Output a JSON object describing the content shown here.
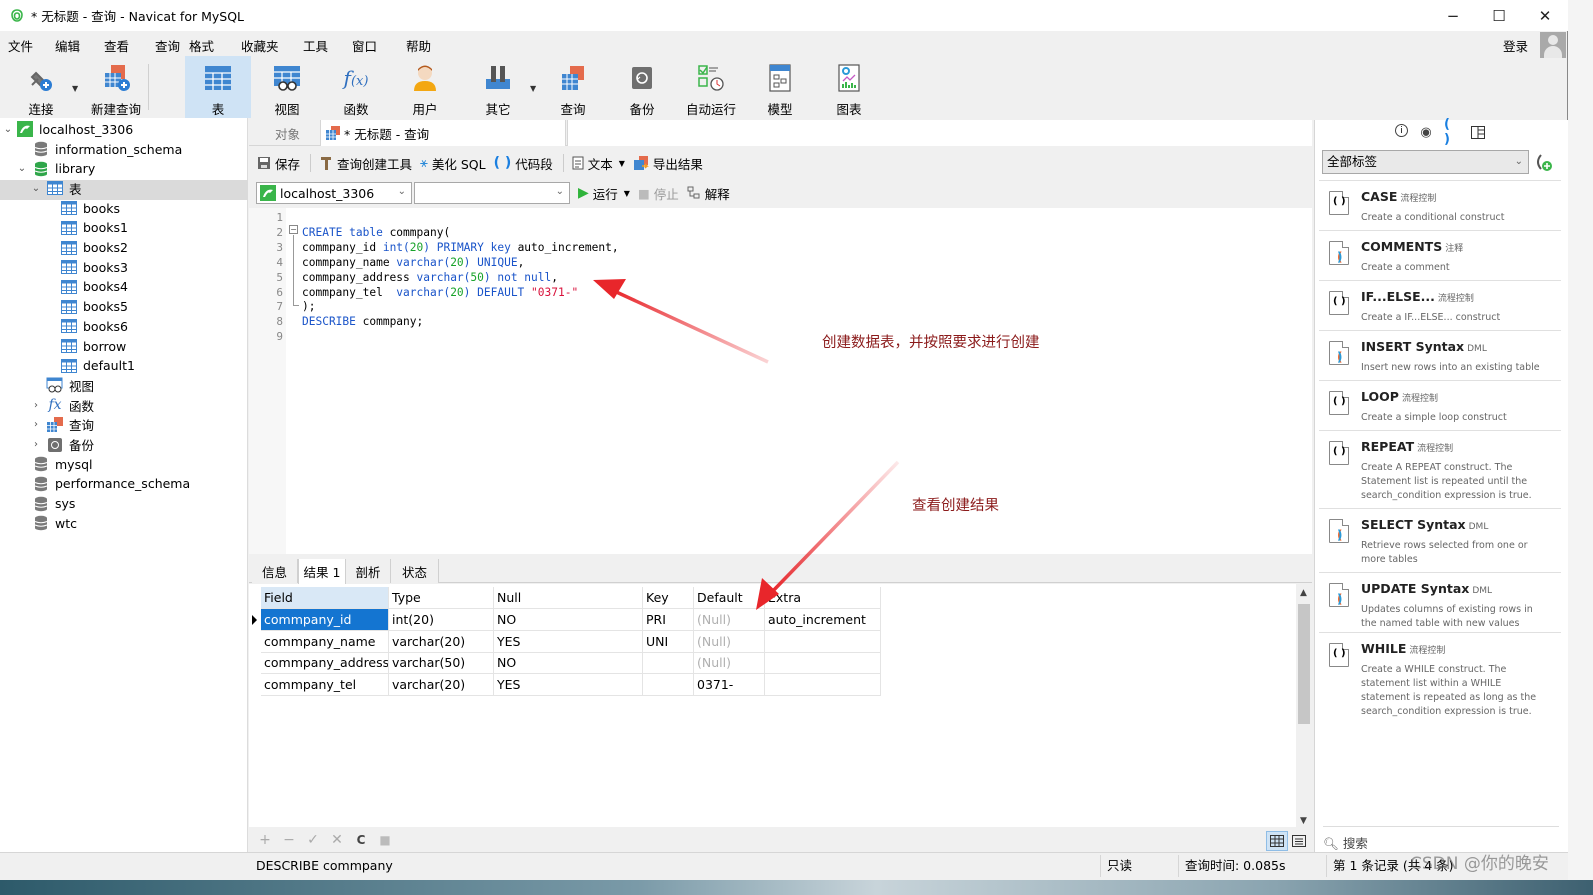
{
  "window": {
    "title": "* 无标题 - 查询 - Navicat for MySQL",
    "controls": {
      "minimize": "−",
      "maximize": "☐",
      "close": "✕"
    }
  },
  "menubar": {
    "items": [
      "文件",
      "编辑",
      "查看",
      "查询",
      "格式",
      "收藏夹",
      "工具",
      "窗口",
      "帮助"
    ],
    "login": "登录"
  },
  "toolbar": {
    "buttons": [
      {
        "label": "连接",
        "icon": "plug-add-icon"
      },
      {
        "label": "新建查询",
        "icon": "new-query-icon"
      },
      {
        "label": "表",
        "icon": "table-icon",
        "active": true
      },
      {
        "label": "视图",
        "icon": "view-icon"
      },
      {
        "label": "函数",
        "icon": "function-icon"
      },
      {
        "label": "用户",
        "icon": "user-icon"
      },
      {
        "label": "其它",
        "icon": "tools-icon"
      },
      {
        "label": "查询",
        "icon": "query-icon"
      },
      {
        "label": "备份",
        "icon": "backup-icon"
      },
      {
        "label": "自动运行",
        "icon": "schedule-icon"
      },
      {
        "label": "模型",
        "icon": "model-icon"
      },
      {
        "label": "图表",
        "icon": "chart-icon"
      }
    ]
  },
  "navigator": {
    "connection": "localhost_3306",
    "items": [
      {
        "label": "information_schema",
        "type": "database"
      },
      {
        "label": "library",
        "type": "database-open"
      },
      {
        "label": "表",
        "type": "table-group",
        "selected": true
      },
      {
        "label": "books",
        "type": "table"
      },
      {
        "label": "books1",
        "type": "table"
      },
      {
        "label": "books2",
        "type": "table"
      },
      {
        "label": "books3",
        "type": "table"
      },
      {
        "label": "books4",
        "type": "table"
      },
      {
        "label": "books5",
        "type": "table"
      },
      {
        "label": "books6",
        "type": "table"
      },
      {
        "label": "borrow",
        "type": "table"
      },
      {
        "label": "default1",
        "type": "table"
      },
      {
        "label": "视图",
        "type": "view-group"
      },
      {
        "label": "函数",
        "type": "function-group"
      },
      {
        "label": "查询",
        "type": "query-group"
      },
      {
        "label": "备份",
        "type": "backup-group"
      },
      {
        "label": "mysql",
        "type": "database"
      },
      {
        "label": "performance_schema",
        "type": "database"
      },
      {
        "label": "sys",
        "type": "database"
      },
      {
        "label": "wtc",
        "type": "database"
      }
    ]
  },
  "tabs": {
    "objects": "对象",
    "query": "* 无标题 - 查询"
  },
  "query_toolbar": {
    "save": "保存",
    "builder": "查询创建工具",
    "beautify": "美化 SQL",
    "snippet": "代码段",
    "text": "文本",
    "export": "导出结果"
  },
  "run_bar": {
    "connection": "localhost_3306",
    "database": "",
    "run": "运行",
    "stop": "停止",
    "explain": "解释"
  },
  "editor": {
    "line_numbers": [
      "1",
      "2",
      "3",
      "4",
      "5",
      "6",
      "7",
      "8",
      "9"
    ],
    "lines": [
      [],
      [
        {
          "t": "CREATE table",
          "c": "kw"
        },
        {
          "t": " commpany(",
          "c": ""
        }
      ],
      [
        {
          "t": "commpany_id ",
          "c": ""
        },
        {
          "t": "int(",
          "c": "kw"
        },
        {
          "t": "20",
          "c": "num"
        },
        {
          "t": ") PRIMARY key",
          "c": "kw"
        },
        {
          "t": " auto_increment,",
          "c": ""
        }
      ],
      [
        {
          "t": "commpany_name ",
          "c": ""
        },
        {
          "t": "varchar(",
          "c": "kw"
        },
        {
          "t": "20",
          "c": "num"
        },
        {
          "t": ") UNIQUE",
          "c": "kw"
        },
        {
          "t": ",",
          "c": ""
        }
      ],
      [
        {
          "t": "commpany_address ",
          "c": ""
        },
        {
          "t": "varchar(",
          "c": "kw"
        },
        {
          "t": "50",
          "c": "num"
        },
        {
          "t": ") not null",
          "c": "kw"
        },
        {
          "t": ",",
          "c": ""
        }
      ],
      [
        {
          "t": "commpany_tel  ",
          "c": ""
        },
        {
          "t": "varchar(",
          "c": "kw"
        },
        {
          "t": "20",
          "c": "num"
        },
        {
          "t": ") DEFAULT ",
          "c": "kw"
        },
        {
          "t": "\"0371-\"",
          "c": "str"
        }
      ],
      [
        {
          "t": ");",
          "c": ""
        }
      ],
      [
        {
          "t": "DESCRIBE",
          "c": "kw"
        },
        {
          "t": " commpany;",
          "c": ""
        }
      ],
      []
    ]
  },
  "annotations": {
    "create_note": "创建数据表，并按照要求进行创建",
    "result_note": "查看创建结果",
    "arrow_color": "#e8262b"
  },
  "result_tabs": [
    "信息",
    "结果 1",
    "剖析",
    "状态"
  ],
  "result_grid": {
    "columns": [
      "Field",
      "Type",
      "Null",
      "Key",
      "Default",
      "Extra"
    ],
    "rows": [
      [
        "commpany_id",
        "int(20)",
        "NO",
        "PRI",
        "(Null)",
        "auto_increment"
      ],
      [
        "commpany_name",
        "varchar(20)",
        "YES",
        "UNI",
        "(Null)",
        ""
      ],
      [
        "commpany_address",
        "varchar(50)",
        "NO",
        "",
        "(Null)",
        ""
      ],
      [
        "commpany_tel",
        "varchar(20)",
        "YES",
        "",
        "0371-",
        ""
      ]
    ]
  },
  "grid_toolbar": {
    "add": "+",
    "remove": "−",
    "apply": "✓",
    "discard": "✕",
    "refresh": "C",
    "stop": "■"
  },
  "statusbar": {
    "sql": "DESCRIBE commpany",
    "mode": "只读",
    "query_time": "查询时间: 0.085s",
    "record": "第 1 条记录 (共 4 条)"
  },
  "watermark": "CSDN @你的晚安",
  "snippets_panel": {
    "filter": "全部标签",
    "search_placeholder": "搜索",
    "items": [
      {
        "title": "CASE",
        "tag": "流程控制",
        "desc": "Create a conditional construct",
        "kind": "flow"
      },
      {
        "title": "COMMENTS",
        "tag": "注释",
        "desc": "Create a comment",
        "kind": "dml"
      },
      {
        "title": "IF...ELSE...",
        "tag": "流程控制",
        "desc": "Create a IF...ELSE... construct",
        "kind": "flow"
      },
      {
        "title": "INSERT Syntax",
        "tag": "DML",
        "desc": "Insert new rows into an existing table",
        "kind": "dml"
      },
      {
        "title": "LOOP",
        "tag": "流程控制",
        "desc": "Create a simple loop construct",
        "kind": "flow"
      },
      {
        "title": "REPEAT",
        "tag": "流程控制",
        "desc": "Create A REPEAT construct. The Statement list is repeated until the search_condition expression is true.",
        "kind": "flow"
      },
      {
        "title": "SELECT Syntax",
        "tag": "DML",
        "desc": "Retrieve rows selected from one or more tables",
        "kind": "dml"
      },
      {
        "title": "UPDATE Syntax",
        "tag": "DML",
        "desc": "Updates columns of existing rows in the named table with new values",
        "kind": "dml"
      },
      {
        "title": "WHILE",
        "tag": "流程控制",
        "desc": "Create a WHILE construct. The statement list within a WHILE statement is repeated as long as the search_condition expression is true.",
        "kind": "flow"
      }
    ]
  }
}
